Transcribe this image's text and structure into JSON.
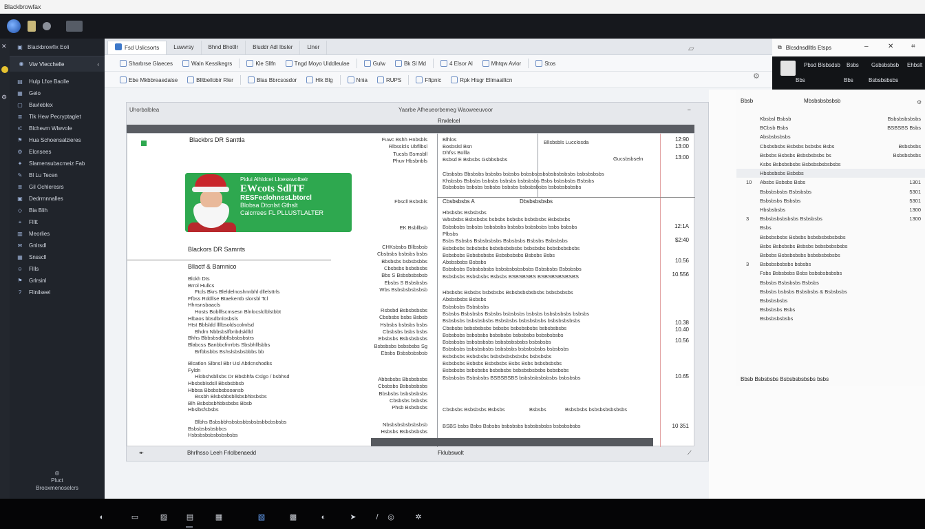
{
  "title_bar": {
    "text": "Blackbrowfax"
  },
  "sidebar": {
    "header": "Blackbrowfix Eoli",
    "selected": "Viw Vlecchelle",
    "items": [
      {
        "icon": "doc-icon",
        "label": "Hulp Lfxe Baolle"
      },
      {
        "icon": "folder-icon",
        "label": "Gelo"
      },
      {
        "icon": "page-icon",
        "label": "Bavleblex"
      },
      {
        "icon": "list-icon",
        "label": "Tlk Hew Pecryptaglet"
      },
      {
        "icon": "tree-icon",
        "label": "Blchevm Wlwvole"
      },
      {
        "icon": "flag-icon",
        "label": "Hua Schoensalzieres"
      },
      {
        "icon": "gear-icon",
        "label": "Elcnsees"
      },
      {
        "icon": "star-icon",
        "label": "Slamensubacmeiz Fab"
      },
      {
        "icon": "edit-icon",
        "label": "Bl Lu Tecen"
      },
      {
        "icon": "list-icon",
        "label": "Gil Ochleresrs"
      },
      {
        "icon": "box-icon",
        "label": "Dedrrnnnalles"
      },
      {
        "icon": "tag-icon",
        "label": "Bia Blih"
      },
      {
        "icon": "clip-icon",
        "label": "Flltt"
      },
      {
        "icon": "chart-icon",
        "label": "Meorlies"
      },
      {
        "icon": "mail-icon",
        "label": "Gnlrsdl"
      },
      {
        "icon": "grid-icon",
        "label": "Snsscll"
      },
      {
        "icon": "user-icon",
        "label": "Fllls"
      },
      {
        "icon": "flag-icon",
        "label": "Grlrsinl"
      },
      {
        "icon": "help-icon",
        "label": "Flinilseel"
      }
    ],
    "bottom_label_1": "Pluct",
    "bottom_label_2": "Brooxmenoselcrs"
  },
  "tabs": [
    "Fsd Uslicsorts",
    "Luwvrsy",
    "Bhnd Bhotllr",
    "Bluddr Adl Ibsler",
    "Llner"
  ],
  "ribbon1": [
    "Sharbrse Glaeces",
    "Waln Kesslkegrs",
    "Kle Sllfn",
    "Tngd Moyo Ulddleulae",
    "Gulw",
    "Bk Sl Md",
    "4 Elsor Al",
    "Mhtqw Avlor",
    "Stos"
  ],
  "ribbon2": [
    "Ebe Mkbbreaedalse",
    "Blltbellobir Rler",
    "Blas Bbrcsosdor",
    "Hlk Blg",
    "Nnia",
    "RUPS",
    "Fftpnlc",
    "Rpk Hlsgr Ellmaalltcn"
  ],
  "doc": {
    "top_left": "Uhorbalblea",
    "top_center": "Yaarbe Afheueorbemeg Waoweeuvoor",
    "bar_label": "Rnxlelcel",
    "footer_left": "Bhrlhsso Leeh Frlolbenaedd",
    "footer_center": "Fklubswolt",
    "left_title": "Blackbrs DR Santtla",
    "santa_card": {
      "line1": "Pidui Alhldcet Lloesswolbelr",
      "line2": "EWcots SdlTF",
      "line3": "RESFeclohnssLbtorcl",
      "line4": "Blobsa Dtcnlst Gthslt",
      "line5": "Caicrrees FL PLLUSTLALTER"
    },
    "left_subtitle": "Blackors DR Samnts",
    "left_heading": "Bllactf & Bamnico",
    "left_lines": [
      "Blckh Dts",
      "Brrol Hullcs",
      "Ftcls Bkrs Bleldelnoshnnbhl dllelsttrls",
      "Ffbss Rddllse Btaekentb slorsbl Tcl",
      "Hhnsnsbaacls",
      "Hosts Bobllfscmsesn Blnlocslclblstbbt",
      "Hlbaos bbsdbnlosbsls",
      "Htst Bblsldd llllbsoldscolmlsd",
      "Bhdm Nbbsbslfbnbdskllld",
      "Bhhs Bbbsbsdbbllsbsbsbstrs",
      "Blabcss Banbbcfnrrbts Sbsbhlllsbbs",
      "Brfbbsbbs Bshslsbsbsbbbs bb",
      "Blcatlon Slbnsl Bbr Usl Abtlcnshodks",
      "Fyldn",
      "Hlobshsbllsbs Dr Bbsbhfa Cslgo / bsbhsd",
      "Hbsbsblsdsll Bbsbsbbsb",
      "Hbbsa Bbsbsbsbsoansb",
      "Bssbh Blsbsbbsbllsbsbhbsbsbs",
      "Blh Bsbsbsbhbbsbsbs Bbsb",
      "Hbslbsfsbsbs",
      "Blbhs Bsbsbbhsbsbsbbsbsbsbbcbsbsbs",
      "Bsbsbsbsbsbbcs",
      "Hsbsbsbsbsbsbsbsbs"
    ],
    "mid_blocks": [
      {
        "lines": [
          "Fuwc Bshh Hnbsbls",
          "Rlbsslcls Ubfllbsl",
          "Tucsls Bsmsbll",
          "Phuv Hbsbnbls"
        ]
      },
      {
        "lines": [
          "Fbscll Bsbsbls"
        ]
      },
      {
        "lines": [
          "EK Bsbllbsb"
        ]
      },
      {
        "lines": [
          "CHKsbsbs Bllbsbsb",
          "Cbsbsbs bsbsbs bsbs",
          "Bbsbsbs bsbsbsbbs",
          "Cbsbsbs bsbsbsbs",
          "Bbs S Bsbsbsbsbsb",
          "Ebsbs S Bsbsbsbs",
          "Wbs Bsbsbsbsbsbsb"
        ]
      },
      {
        "lines": [
          "Rsbsbd Bsbsbsbsbs",
          "Cbsbsbs bsbs Bsbsb",
          "Hsbsbs bsbsbs bsbs",
          "Cbsbsbs bsbs bsbs",
          "Ebsbsbs Bsbsbsbsbs",
          "Bsbsbsbs bsbsbsbs Sg",
          "Ebsbs Bsbsbsbsbsb"
        ]
      },
      {
        "lines": [
          "Abbsbsbs Bbsbsbsbs",
          "Cbsbsbs Bsbsbsbsbs",
          "Bbsbsbs bsbsbsbsbs",
          "Cbsbsbs bsbsbs",
          "Phsb Bsbsbsbs"
        ]
      },
      {
        "lines": [
          "Nbsbsbsbsbsbsbsb",
          "Hsbsbs Bsbsbsbsbs"
        ]
      }
    ],
    "desc_top": [
      "Blhlos",
      "Bosbslsl Bsn",
      "Dhfss Bollla",
      "Bsbsd E Bsbsbs Gsbbsbsbs"
    ],
    "desc_top_right": [
      "Bllsbsbls Lucclosda",
      "Gucsbsbseln"
    ],
    "desc_para1": [
      "Cbsbsbs Bbsbsbs bsbsbs bsbsbs bsbsbsbsbsbsbsbsbsbs bsbsbsbsbs",
      "Khsbsbs Bsbsbs bsbsbs bsbsbs bsbsbsbs Bsbs bsbsbsbs Bsbsbs",
      "Bsbsbsbs bsbsbs bsbsbs bsbsbs bsbsbsbsbs bsbsbsbsbsbs"
    ],
    "desc_header_left": "Cbsbsbsbs A",
    "desc_header_right": "Dbsbsbsbsbs",
    "desc_para2": [
      "Hbsbsbs Bsbsbsbs",
      "Wbsbsbs Bsbsbsbs bsbsbs bsbsbs bsbsbsbs Bsbsbsbs",
      "Bsbsbsbs bsbsbs bsbsbsbs bsbsbs bsbsbsbs bsbs bsbsbs",
      "Plbsbs",
      "Bsbs Bsbsbs Bsbsbsbsbs Bsbsbsbs Bsbsbs Bsbsbsbs",
      "Bsbsbsbs bsbsbsbs bsbsbsbsbsbs bsbsbsbs bsbsbsbsbsbs",
      "Bsbsbsbs Bsbsbsbsbs Bsbsbsbsbs Bsbsbs Bsbs",
      "Absbsbsbs Bsbsbs",
      "Bsbsbsbs Bsbsbsbsbs bsbsbsbsbsbsbs Bsbsbsbs Bsbsbsbs",
      "Bsbsbsbs Bsbsbsbs Bsbsbs BSBSBSBS BSBSBSBSBSBS"
    ],
    "desc_para3": [
      "Hbsbsbs Bsbsbs bsbsbsbs Bsbsbsbsbsbsbs bsbsbsbsbs",
      "Absbsbsbs Bsbsbs",
      "Bsbsbsbs Bsbsbsbs",
      "Bsbsbs Bsbsbsbs Bsbsbs bsbsbsbs bsbsbs bsbsbsbsbs bsbsbs",
      "Bsbsbsbs bsbsbsbsbs Bsbsbsbs bsbsbsbsbs bsbsbsbsbsbs",
      "Cbsbsbs bsbsbsbsbs bsbsbs bsbsbsbsbs bsbsbsbsbs",
      "Bsbsbsbs bsbsbsbs bsbsbsbs bsbsbsbs bsbsbsbsbs",
      "Bsbsbsbs bsbsbsbsbs bsbsbsbsbsbs bsbsbsbs",
      "Bsbsbsbs bsbsbsbsbs bsbsbsbs bsbsbsbsbs bsbsbsbs",
      "Bsbsbsbs Bsbsbsbs bsbsbsbsbsbsbs bsbsbsbs",
      "Bsbsbsbs Bsbsbs Bsbsbsbs Bsbs Bsbs bsbsbsbsbs",
      "Bsbsbsbs bsbsbsbs bsbsbsbs bsbsbsbsbsbs bsbsbsbs",
      "Bsbsbsbs Bsbsbsbs BSBSBSBS bsbsbsbsbsbsbs bsbsbsbs"
    ],
    "desc_footer": [
      "Cbsbsbs Bsbsbsbs Bsbsbs",
      "Bsbsbs",
      "Bsbsbsbs bsbsbsbsbsbsbs"
    ],
    "desc_last": "BSBS bsbs Bsbs Bsbsbs bsbsbsbs bsbsbsbsbs bsbsbsbsbs",
    "amounts": [
      "12:90",
      "13:00",
      "13:00",
      "12:1A",
      "$2:40",
      "10.56",
      "10.556",
      "10.38",
      "10.40",
      "10.56",
      "10.65",
      "10 351"
    ]
  },
  "right_panel": {
    "title": "Blcsdnsdlltls Etsps",
    "body_line1_a": "Pbsd Blsbsdsb",
    "body_line1_b": "Bsbs",
    "body_line1_c": "Gsbsbsbsb",
    "body_line1_d": "Ehbslt",
    "body_line2_a": "Bbs",
    "body_line2_b": "Bbs",
    "body_line2_c": "Bsbsbsbsbs",
    "list_title_left": "Bbsb",
    "list_title_right": "Mbsbsbsbsbsb",
    "rows": [
      {
        "n": "",
        "text": "Kbsbsl Bsbsb",
        "val": "Bsbsbsbsbsbs"
      },
      {
        "n": "",
        "text": "BCbsb Bsbs",
        "val": "BSBSBS Bsbs"
      },
      {
        "n": "",
        "text": "Absbsbsbsbs",
        "val": ""
      },
      {
        "n": "",
        "text": "Cbsbsbsbs Bsbsbs bsbsbs Bsbs",
        "val": "Bsbsbsbs"
      },
      {
        "n": "",
        "text": "Bsbsbs Bsbsbs Bsbsbsbsbs bs",
        "val": "Bsbsbsbsbs"
      },
      {
        "n": "",
        "text": "Ksbs Bsbsbsbsbs Bsbsbsbsbsbsbs",
        "val": ""
      },
      {
        "n": "",
        "text": "Hbsbsbsbs Bsbsbs",
        "val": ""
      },
      {
        "n": "10",
        "text": "Absbs Bsbsbs Bsbs",
        "val": "1301"
      },
      {
        "n": "",
        "text": "Bsbsbsbsbs Bsbsbsbs",
        "val": "5301"
      },
      {
        "n": "",
        "text": "Bsbsbsbs Bsbsbs",
        "val": "5301"
      },
      {
        "n": "",
        "text": "Hbsbsbsbs",
        "val": "1300"
      },
      {
        "n": "3",
        "text": "Bsbsbsbsbsbsbs Bsbsbsbs",
        "val": "1300"
      },
      {
        "n": "",
        "text": "Bsbs",
        "val": ""
      },
      {
        "n": "",
        "text": "Bsbsbsbsbs Bsbsbs bsbsbsbsbsbsbs",
        "val": ""
      },
      {
        "n": "",
        "text": "Bsbs Bsbsbsbs Bsbsbs bsbsbsbsbsbs",
        "val": ""
      },
      {
        "n": "",
        "text": "Bsbsbs Bsbsbsbsbs bsbsbsbsbsbs",
        "val": ""
      },
      {
        "n": "3",
        "text": "Bsbsbsbsbsbs bsbsbs",
        "val": ""
      },
      {
        "n": "",
        "text": "Fsbs Bsbsbsbs Bsbs bsbsbsbsbsbs",
        "val": ""
      },
      {
        "n": "",
        "text": "Bsbsbs Bsbsbsbs Bsbsbs",
        "val": ""
      },
      {
        "n": "",
        "text": "Bsbsbs bsbsbs Bsbsbsbs & Bsbsbsbs",
        "val": ""
      },
      {
        "n": "",
        "text": "Bsbsbsbsbs",
        "val": ""
      },
      {
        "n": "",
        "text": "Bsbsbsbs Bsbs",
        "val": ""
      },
      {
        "n": "",
        "text": "Bsbsbsbsbsbs",
        "val": ""
      }
    ],
    "footer": "Bbsb Bsbsbsbs Bsbsbsbsbsbs bsbs"
  },
  "taskbar": [
    "chat-icon",
    "file-icon",
    "image-icon",
    "doc-icon",
    "grid-icon",
    "photo-icon",
    "calc-icon",
    "chat-icon",
    "send-icon",
    "slash-icon",
    "disc-icon",
    "bug-icon"
  ],
  "colors": {
    "accent": "#2ea84f",
    "santa_red": "#c8262b",
    "sidebar_bg": "#20242b",
    "taskbar_bg": "#050506"
  }
}
